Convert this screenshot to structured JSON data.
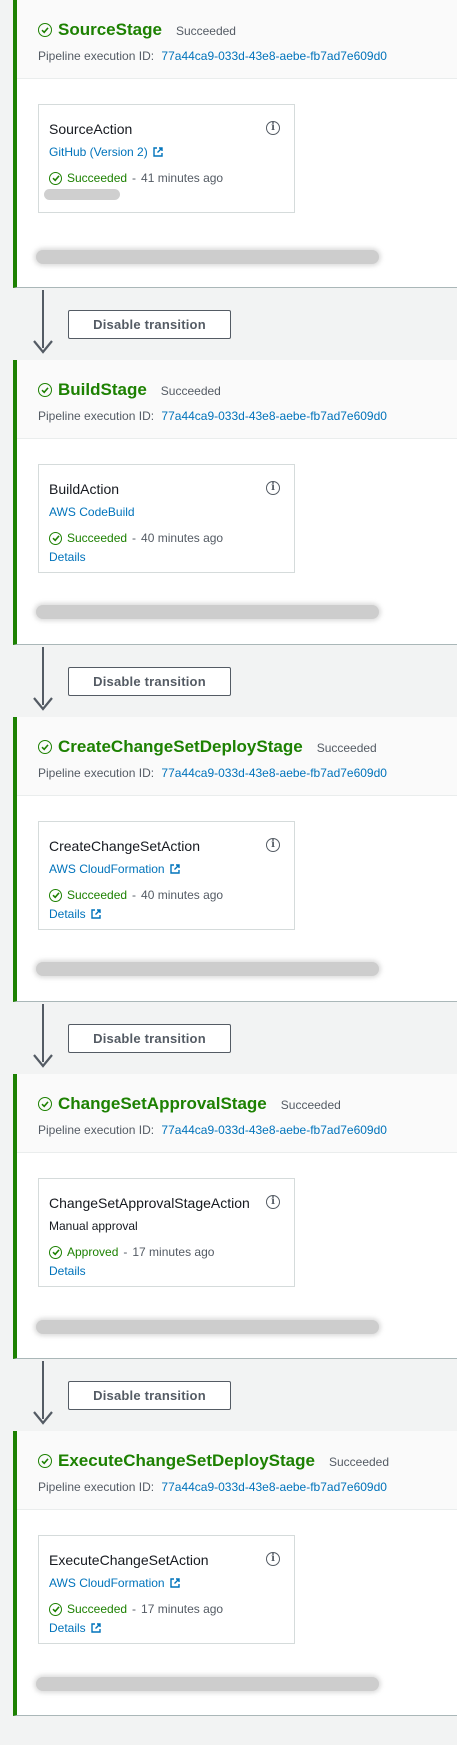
{
  "colors": {
    "success": "#1d8102",
    "link": "#0073bb",
    "muted": "#545b64"
  },
  "stages": [
    {
      "name": "SourceStage",
      "status": "Succeeded",
      "exec_label": "Pipeline execution ID:",
      "exec_id": "77a44ca9-033d-43e8-aebe-fb7ad7e609d0",
      "action": {
        "name": "SourceAction",
        "provider": "GitHub (Version 2)",
        "status": "Succeeded",
        "separator": "-",
        "time": "41 minutes ago",
        "details": ""
      }
    },
    {
      "name": "BuildStage",
      "status": "Succeeded",
      "exec_label": "Pipeline execution ID:",
      "exec_id": "77a44ca9-033d-43e8-aebe-fb7ad7e609d0",
      "action": {
        "name": "BuildAction",
        "provider": "AWS CodeBuild",
        "status": "Succeeded",
        "separator": "-",
        "time": "40 minutes ago",
        "details": "Details"
      }
    },
    {
      "name": "CreateChangeSetDeployStage",
      "status": "Succeeded",
      "exec_label": "Pipeline execution ID:",
      "exec_id": "77a44ca9-033d-43e8-aebe-fb7ad7e609d0",
      "action": {
        "name": "CreateChangeSetAction",
        "provider": "AWS CloudFormation",
        "status": "Succeeded",
        "separator": "-",
        "time": "40 minutes ago",
        "details": "Details"
      }
    },
    {
      "name": "ChangeSetApprovalStage",
      "status": "Succeeded",
      "exec_label": "Pipeline execution ID:",
      "exec_id": "77a44ca9-033d-43e8-aebe-fb7ad7e609d0",
      "action": {
        "name": "ChangeSetApprovalStageAction",
        "provider": "Manual approval",
        "status": "Approved",
        "separator": "-",
        "time": "17 minutes ago",
        "details": "Details"
      }
    },
    {
      "name": "ExecuteChangeSetDeployStage",
      "status": "Succeeded",
      "exec_label": "Pipeline execution ID:",
      "exec_id": "77a44ca9-033d-43e8-aebe-fb7ad7e609d0",
      "action": {
        "name": "ExecuteChangeSetAction",
        "provider": "AWS CloudFormation",
        "status": "Succeeded",
        "separator": "-",
        "time": "17 minutes ago",
        "details": "Details"
      }
    }
  ],
  "transitions": [
    {
      "button_label": "Disable transition"
    },
    {
      "button_label": "Disable transition"
    },
    {
      "button_label": "Disable transition"
    },
    {
      "button_label": "Disable transition"
    }
  ]
}
